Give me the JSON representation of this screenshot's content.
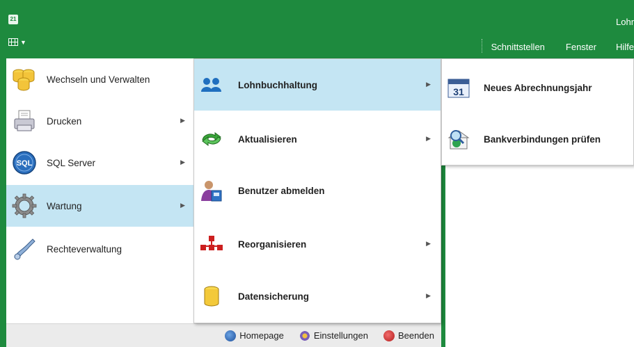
{
  "window": {
    "title": "Lohn",
    "menu": [
      "Schnittstellen",
      "Fenster",
      "Hilfe"
    ]
  },
  "main_menu": {
    "items": [
      {
        "label": "Wechseln und Verwalten",
        "icon": "database-cylinders-icon",
        "has_submenu": false,
        "active": false
      },
      {
        "label": "Drucken",
        "icon": "printer-icon",
        "has_submenu": true,
        "active": false
      },
      {
        "label": "SQL Server",
        "icon": "sql-server-icon",
        "has_submenu": true,
        "active": false
      },
      {
        "label": "Wartung",
        "icon": "gear-icon",
        "has_submenu": true,
        "active": true
      },
      {
        "label": "Rechteverwaltung",
        "icon": "key-icon",
        "has_submenu": false,
        "active": false
      }
    ]
  },
  "submenu": {
    "items": [
      {
        "label": "Lohnbuchhaltung",
        "icon": "users-icon",
        "has_submenu": true,
        "active": true
      },
      {
        "label": "Aktualisieren",
        "icon": "refresh-arrows-icon",
        "has_submenu": true,
        "active": false
      },
      {
        "label": "Benutzer abmelden",
        "icon": "user-logout-icon",
        "has_submenu": false,
        "active": false
      },
      {
        "label": "Reorganisieren",
        "icon": "hierarchy-icon",
        "has_submenu": true,
        "active": false
      },
      {
        "label": "Datensicherung",
        "icon": "database-icon",
        "has_submenu": true,
        "active": false
      }
    ]
  },
  "submenu2": {
    "items": [
      {
        "label": "Neues Abrechnungsjahr",
        "icon": "calendar-icon",
        "calendar_day": "31"
      },
      {
        "label": "Bankverbindungen prüfen",
        "icon": "bank-search-icon"
      }
    ]
  },
  "bottom_bar": {
    "homepage": "Homepage",
    "settings": "Einstellungen",
    "exit": "Beenden"
  },
  "colors": {
    "titlebar": "#1e8a3e",
    "highlight": "#c4e5f3"
  }
}
